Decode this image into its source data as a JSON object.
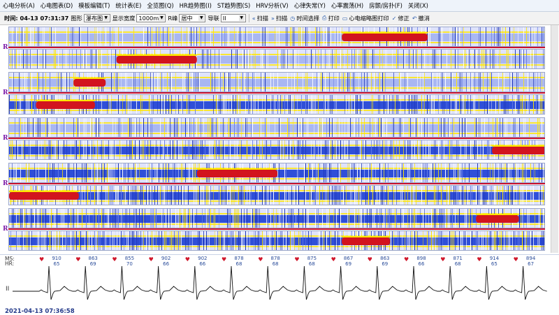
{
  "menu": [
    "心电分析(A)",
    "心电图表(D)",
    "模板编辑(T)",
    "统计表(E)",
    "全览图(Q)",
    "HR趋势图(I)",
    "ST趋势图(S)",
    "HRV分析(V)",
    "心律失常(Y)",
    "心率震荡(H)",
    "房颤/房扑(F)",
    "关闭(X)"
  ],
  "toolbar": {
    "time_label": "时间: 04-13 07:31:37",
    "graph_label": "图形",
    "graph_value": "瀑布图",
    "width_label": "显示宽度",
    "width_value": "1000ms",
    "r_label": "R峰",
    "r_value": "居中",
    "lead_label": "导联",
    "lead_value": "II",
    "scan_back": "扫描",
    "scan_fwd": "扫描",
    "time_select": "时间选择",
    "print": "打印",
    "thumb_print": "心电缩略图打印",
    "fix": "修正",
    "undo": "撤消"
  },
  "strip_marker": "R",
  "ecg": {
    "ms_label": "MS:",
    "hr_label": "HR:",
    "lead": "II",
    "datetime": "2021-04-13 07:36:58",
    "beats": [
      {
        "ms": "910",
        "hr": "65"
      },
      {
        "ms": "863",
        "hr": "69"
      },
      {
        "ms": "855",
        "hr": "70"
      },
      {
        "ms": "902",
        "hr": "66"
      },
      {
        "ms": "902",
        "hr": "66"
      },
      {
        "ms": "878",
        "hr": "68"
      },
      {
        "ms": "878",
        "hr": "68"
      },
      {
        "ms": "875",
        "hr": "68"
      },
      {
        "ms": "867",
        "hr": "69"
      },
      {
        "ms": "863",
        "hr": "69"
      },
      {
        "ms": "898",
        "hr": "66"
      },
      {
        "ms": "871",
        "hr": "68"
      },
      {
        "ms": "914",
        "hr": "65"
      },
      {
        "ms": "894",
        "hr": "67"
      }
    ]
  },
  "colors": {
    "red_line": "#c8102e",
    "r_label": "#7a1aa8",
    "waterfall_blue": "#2f4fd8",
    "waterfall_yellow": "#ffe600",
    "waterfall_red": "#d2141e"
  }
}
